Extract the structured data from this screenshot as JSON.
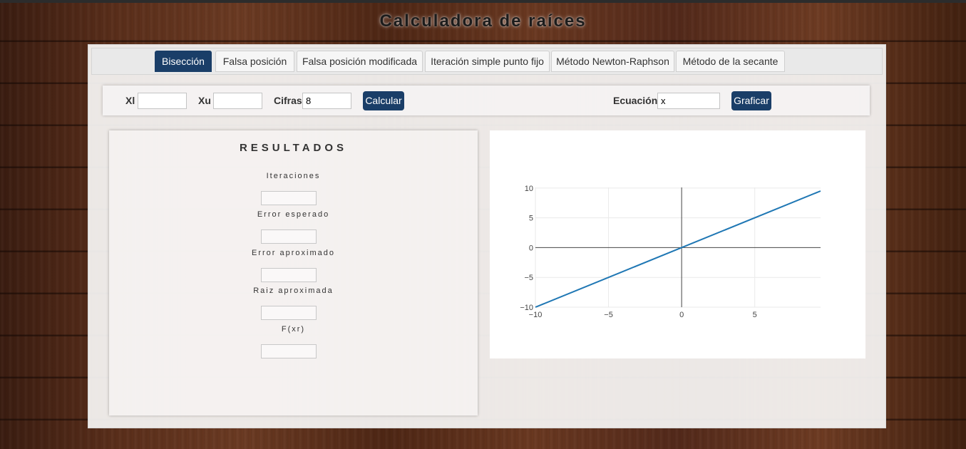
{
  "app": {
    "title": "Calculadora de raíces"
  },
  "tabs": [
    {
      "label": "Bisección",
      "active": true
    },
    {
      "label": "Falsa posición",
      "active": false
    },
    {
      "label": "Falsa posición modificada",
      "active": false
    },
    {
      "label": "Iteración simple punto fijo",
      "active": false
    },
    {
      "label": "Método Newton-Raphson",
      "active": false
    },
    {
      "label": "Método de la secante",
      "active": false
    }
  ],
  "inputs": {
    "xl_label": "Xl",
    "xl_value": "",
    "xu_label": "Xu",
    "xu_value": "",
    "cifras_label": "Cifras",
    "cifras_value": "8",
    "calcular_label": "Calcular",
    "ecuacion_label": "Ecuación",
    "ecuacion_value": "x",
    "graficar_label": "Graficar"
  },
  "results": {
    "title": "RESULTADOS",
    "fields": [
      {
        "label": "Iteraciones",
        "value": ""
      },
      {
        "label": "Error esperado",
        "value": ""
      },
      {
        "label": "Error aproximado",
        "value": ""
      },
      {
        "label": "Raiz aproximada",
        "value": ""
      },
      {
        "label": "F(xr)",
        "value": ""
      }
    ]
  },
  "colors": {
    "accent": "#1a3e68",
    "line": "#1f77b4"
  },
  "chart_data": {
    "type": "line",
    "title": "",
    "xlabel": "",
    "ylabel": "",
    "xlim": [
      -10,
      9.5
    ],
    "ylim": [
      -10,
      9.5
    ],
    "x_ticks": [
      "−10",
      "−5",
      "0",
      "5"
    ],
    "y_ticks": [
      "10",
      "5",
      "0",
      "−5",
      "−10"
    ],
    "grid": true,
    "series": [
      {
        "name": "",
        "x": [
          -10,
          9.5
        ],
        "y": [
          -10,
          9.5
        ]
      }
    ]
  }
}
